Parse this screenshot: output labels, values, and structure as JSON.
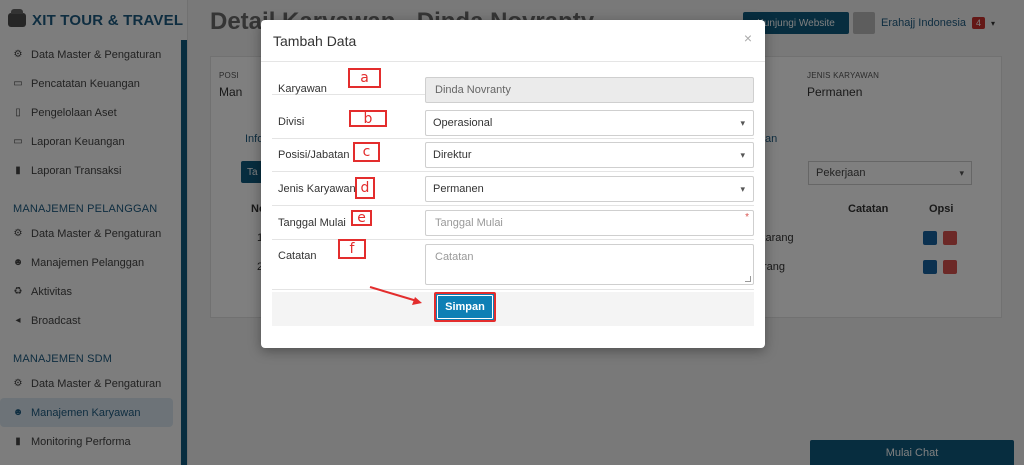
{
  "sidebar": {
    "brand": "XIT TOUR & TRAVEL",
    "items_top": [
      {
        "label": "Data Master & Pengaturan",
        "icon": "gears-icon"
      },
      {
        "label": "Pencatatan Keuangan",
        "icon": "money-icon"
      },
      {
        "label": "Pengelolaan Aset",
        "icon": "inbox-icon"
      },
      {
        "label": "Laporan Keuangan",
        "icon": "money-icon"
      },
      {
        "label": "Laporan Transaksi",
        "icon": "book-icon"
      }
    ],
    "section_pelanggan": "MANAJEMEN PELANGGAN",
    "items_pelanggan": [
      {
        "label": "Data Master & Pengaturan",
        "icon": "gears-icon"
      },
      {
        "label": "Manajemen Pelanggan",
        "icon": "users-icon"
      },
      {
        "label": "Aktivitas",
        "icon": "recycle-icon"
      },
      {
        "label": "Broadcast",
        "icon": "bullhorn-icon"
      }
    ],
    "section_sdm": "MANAJEMEN SDM",
    "items_sdm": [
      {
        "label": "Data Master & Pengaturan",
        "icon": "gears-icon"
      },
      {
        "label": "Manajemen Karyawan",
        "icon": "users-icon",
        "active": true
      },
      {
        "label": "Monitoring Performa",
        "icon": "book-icon"
      }
    ]
  },
  "header": {
    "page_title": "Detail Karyawan - Dinda Novranty",
    "website_button": "Kunjungi Website",
    "user_name": "Erahajj Indonesia",
    "notif_count": "4"
  },
  "background": {
    "posisi_label": "POSI",
    "posisi_value": "Man",
    "jenis_label": "JENIS KARYAWAN",
    "jenis_value": "Permanen",
    "tab_left": "Info",
    "tab_right": "an",
    "add_button": "Ta",
    "filter_select": "Pekerjaan",
    "col_no": "No",
    "col_catatan": "Catatan",
    "col_opsi": "Opsi",
    "row1_no": "1",
    "row1_text": "karang",
    "row2_no": "2",
    "row2_text": "rang"
  },
  "modal": {
    "title": "Tambah Data",
    "close": "×",
    "fields": {
      "karyawan_label": "Karyawan",
      "karyawan_value": "Dinda Novranty",
      "divisi_label": "Divisi",
      "divisi_value": "Operasional",
      "posisi_label": "Posisi/Jabatan",
      "posisi_value": "Direktur",
      "jenis_label": "Jenis Karyawan",
      "jenis_value": "Permanen",
      "tanggal_label": "Tanggal Mulai",
      "tanggal_placeholder": "Tanggal Mulai",
      "tanggal_required": "*",
      "catatan_label": "Catatan",
      "catatan_placeholder": "Catatan"
    },
    "submit": "Simpan"
  },
  "annotations": {
    "a": "a",
    "b": "b",
    "c": "c",
    "d": "d",
    "e": "e",
    "f": "f"
  },
  "chat_button": "Mulai Chat",
  "colors": {
    "primary": "#0e5a7f",
    "button": "#0e7fb5",
    "annotation": "#e32d2d"
  }
}
